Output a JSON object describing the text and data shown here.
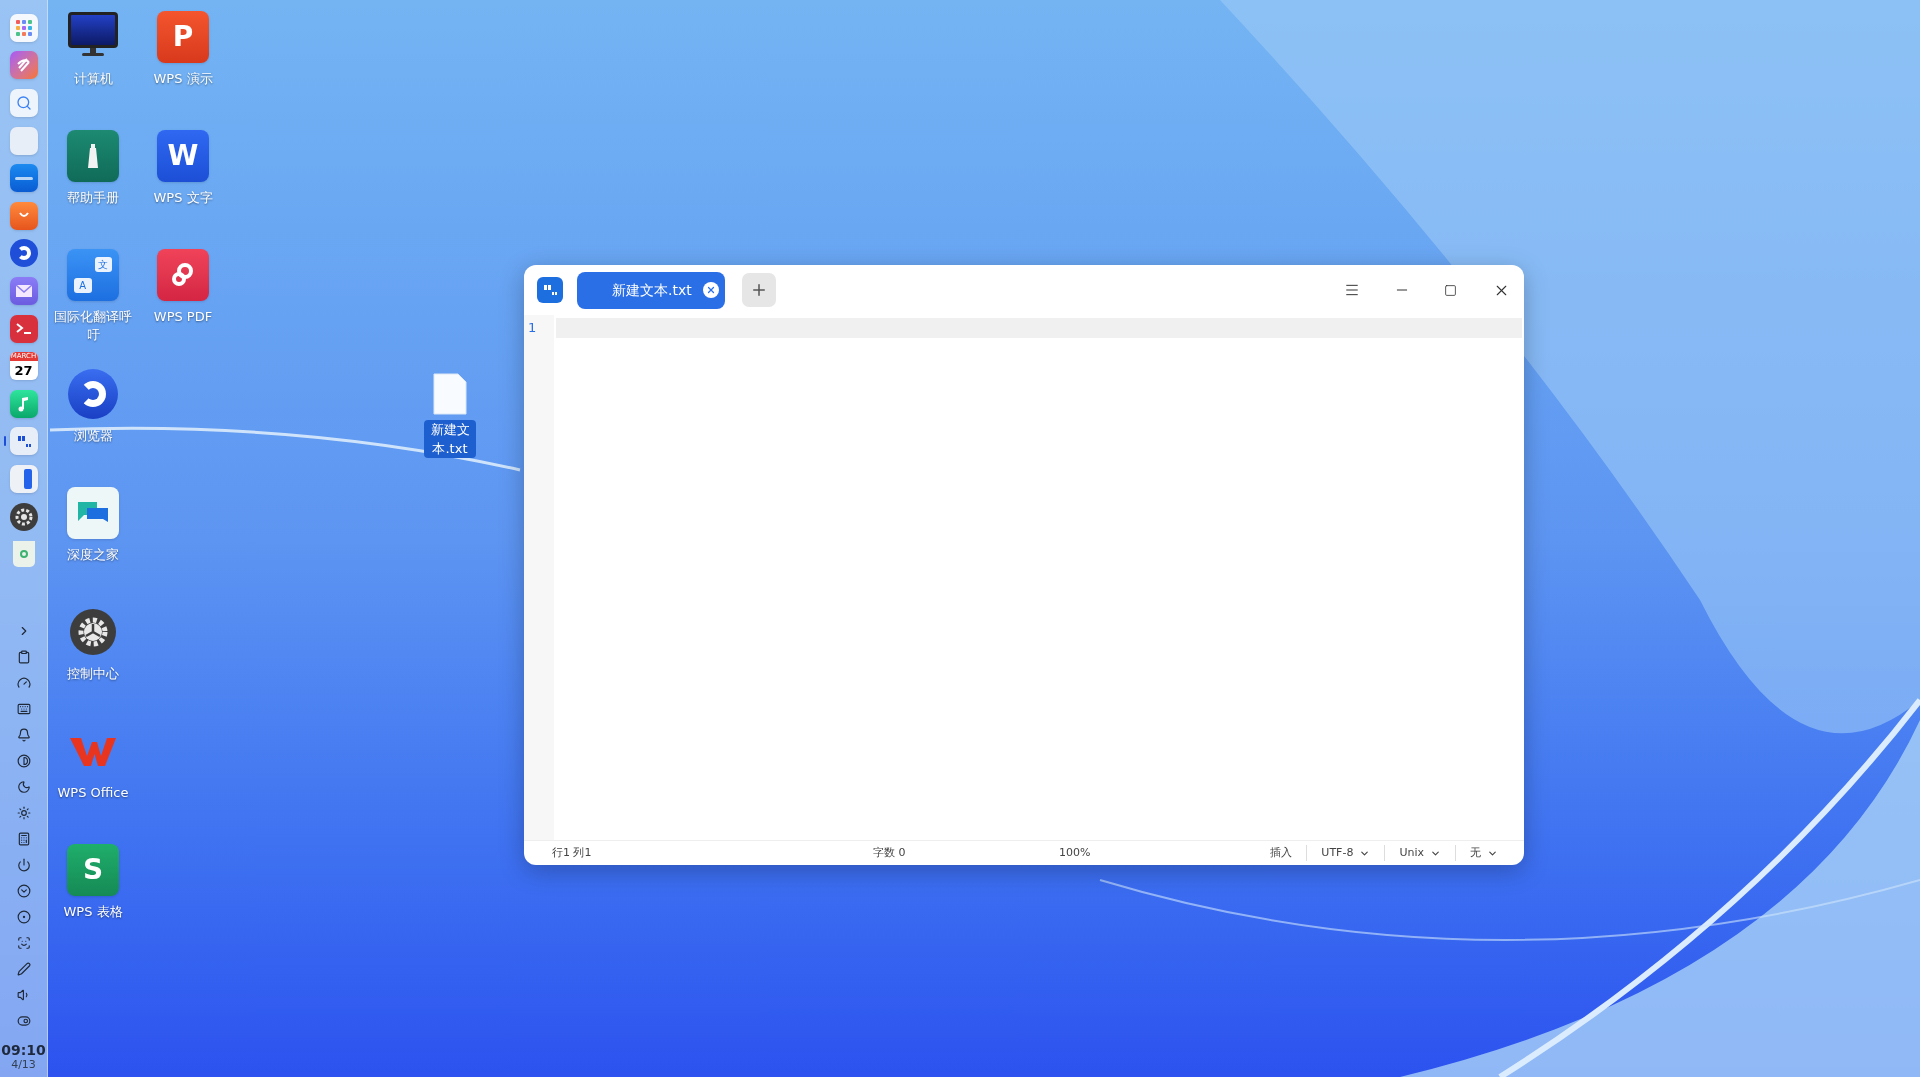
{
  "dock": {
    "apps": [
      {
        "running": false
      },
      {
        "running": false
      },
      {
        "running": false
      },
      {
        "running": false
      },
      {
        "running": false
      },
      {
        "running": false
      },
      {
        "running": false
      },
      {
        "running": false
      },
      {
        "running": false
      },
      {
        "running": false,
        "month": "MARCH",
        "day": "27"
      },
      {
        "running": false
      },
      {
        "running": true
      },
      {
        "running": false
      },
      {
        "running": false
      },
      {
        "running": false
      }
    ],
    "clock": {
      "time": "09:10",
      "date": "4/13"
    }
  },
  "desktop": {
    "icons": [
      {
        "label": "计算机"
      },
      {
        "label": "帮助手册"
      },
      {
        "label": "国际化翻译呼吁",
        "glyphs": [
          "文",
          "A"
        ]
      },
      {
        "label": "浏览器"
      },
      {
        "label": "深度之家"
      },
      {
        "label": "控制中心"
      },
      {
        "label": "WPS Office"
      },
      {
        "label": "WPS 表格",
        "glyph": "S"
      },
      {
        "label": "WPS 演示",
        "glyph": "P"
      },
      {
        "label": "WPS 文字",
        "glyph": "W"
      },
      {
        "label": "WPS PDF"
      }
    ],
    "files": [
      {
        "label": "新建文本.txt",
        "selected": true
      }
    ]
  },
  "editor": {
    "tabs": [
      {
        "label": "新建文本.txt",
        "selected": true
      }
    ],
    "lines": [
      "1"
    ],
    "status_bar": [
      {
        "kind": "text",
        "text": "行1 列1"
      },
      {
        "kind": "text",
        "text": "字数 0"
      },
      {
        "kind": "text",
        "text": "100%"
      },
      {
        "kind": "text",
        "text": "插入"
      },
      {
        "kind": "dropdown",
        "text": "UTF-8"
      },
      {
        "kind": "dropdown",
        "text": "Unix"
      },
      {
        "kind": "dropdown",
        "text": "无"
      }
    ]
  }
}
